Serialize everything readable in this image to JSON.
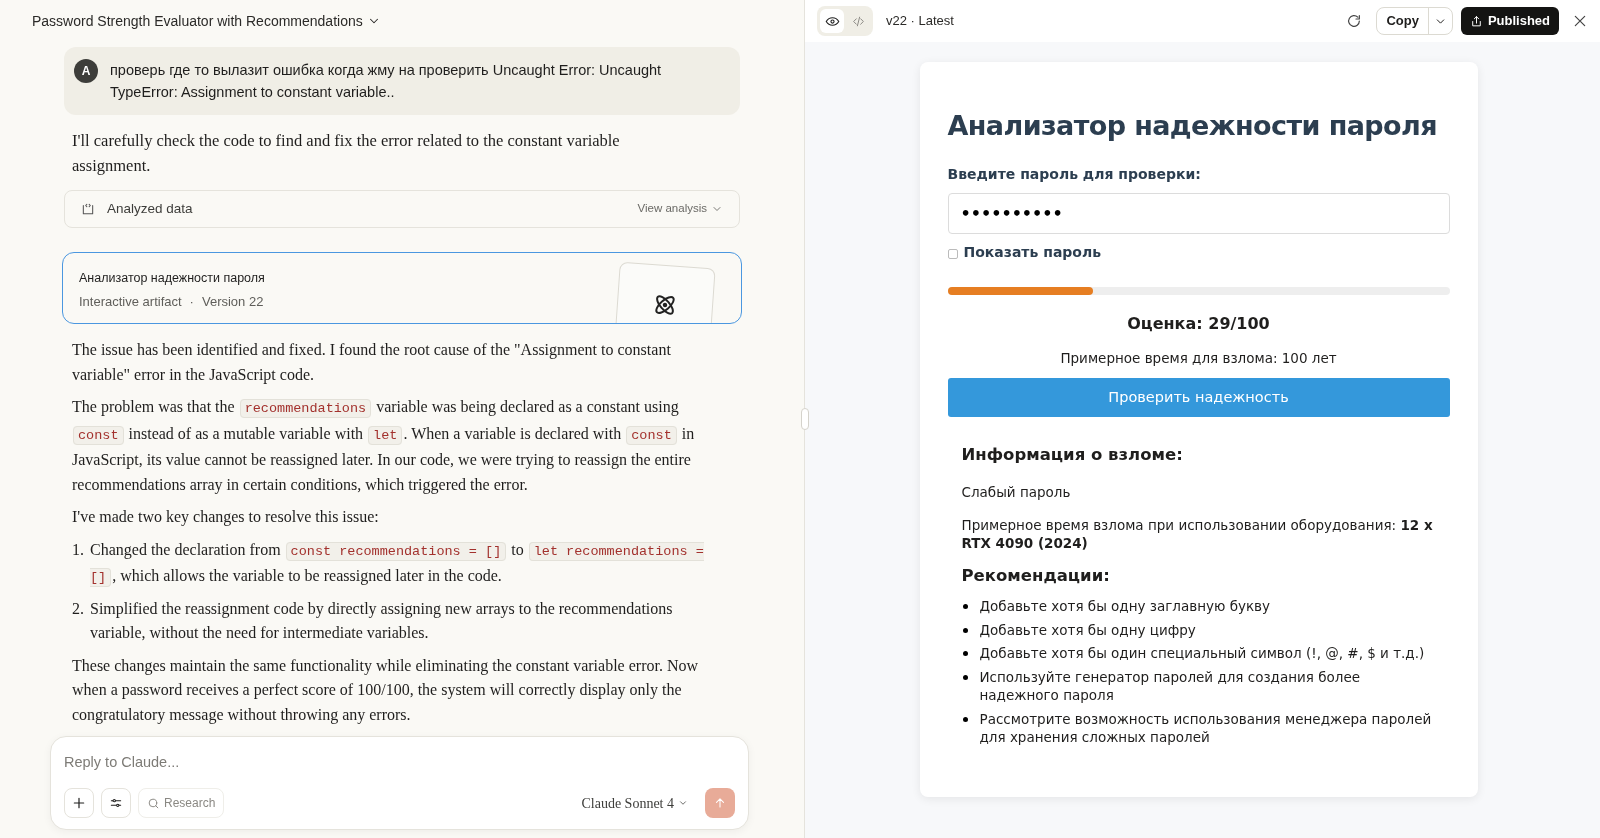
{
  "chat": {
    "title": "Password Strength Evaluator with Recommendations",
    "user_message": {
      "avatar": "A",
      "text": "проверь где то вылазит ошибка когда жму на проверить Uncaught Error: Uncaught TypeError: Assignment to constant variable.."
    },
    "intro": "I'll carefully check the code to find and fix the error related to the constant variable assignment.",
    "analysis": {
      "label": "Analyzed data",
      "action": "View analysis"
    },
    "artifact": {
      "title": "Анализатор надежности пароля",
      "type": "Interactive artifact",
      "separator": "·",
      "version": "Version 22"
    },
    "blocks": [
      {
        "kind": "p",
        "parts": [
          {
            "kind": "text",
            "text": "The issue has been identified and fixed. I found the root cause of the \"Assignment to constant variable\" error in the JavaScript code."
          }
        ]
      },
      {
        "kind": "p",
        "parts": [
          {
            "kind": "text",
            "text": "The problem was that the "
          },
          {
            "kind": "code",
            "text": "recommendations"
          },
          {
            "kind": "text",
            "text": " variable was being declared as a constant using "
          },
          {
            "kind": "code",
            "text": "const"
          },
          {
            "kind": "text",
            "text": " instead of as a mutable variable with "
          },
          {
            "kind": "code",
            "text": "let"
          },
          {
            "kind": "text",
            "text": ". When a variable is declared with "
          },
          {
            "kind": "code",
            "text": "const"
          },
          {
            "kind": "text",
            "text": " in JavaScript, its value cannot be reassigned later. In our code, we were trying to reassign the entire recommendations array in certain conditions, which triggered the error."
          }
        ]
      },
      {
        "kind": "p",
        "parts": [
          {
            "kind": "text",
            "text": "I've made two key changes to resolve this issue:"
          }
        ]
      },
      {
        "kind": "ol",
        "items": [
          {
            "number": "1.",
            "parts": [
              {
                "kind": "text",
                "text": "Changed the declaration from "
              },
              {
                "kind": "code",
                "text": "const recommendations = []"
              },
              {
                "kind": "text",
                "text": " to "
              },
              {
                "kind": "code",
                "text": "let recommendations = []"
              },
              {
                "kind": "text",
                "text": ", which allows the variable to be reassigned later in the code."
              }
            ]
          },
          {
            "number": "2.",
            "parts": [
              {
                "kind": "text",
                "text": "Simplified the reassignment code by directly assigning new arrays to the recommendations variable, without the need for intermediate variables."
              }
            ]
          }
        ]
      },
      {
        "kind": "p",
        "parts": [
          {
            "kind": "text",
            "text": "These changes maintain the same functionality while eliminating the constant variable error. Now when a password receives a perfect score of 100/100, the system will correctly display only the congratulatory message without throwing any errors."
          }
        ]
      }
    ],
    "composer": {
      "placeholder": "Reply to Claude...",
      "research": "Research",
      "model": "Claude Sonnet 4"
    }
  },
  "artifact_panel": {
    "version": "v22 · Latest",
    "views": [
      {
        "kind": "preview",
        "selected": true
      },
      {
        "kind": "code",
        "selected": false
      }
    ],
    "copy": "Copy",
    "publish": "Published",
    "app": {
      "title": "Анализатор надежности пароля",
      "field_label": "Введите пароль для проверки:",
      "password": "••••••••••",
      "show_password": {
        "label": "Показать пароль",
        "checked": false
      },
      "strength": {
        "level": 0.29,
        "color": "#e67e22"
      },
      "score": "Оценка: 29/100",
      "time": "Примерное время для взлома: 100 лет",
      "button": "Проверить надежность",
      "info_title": "Информация о взломе:",
      "info_status": "Слабый пароль",
      "info_hardware": "Примерное время взлома при использовании оборудования: **12 x RTX 4090 (2024)**",
      "rec_title": "Рекомендации:",
      "recommendations": [
        "Добавьте хотя бы одну заглавную букву",
        "Добавьте хотя бы одну цифру",
        "Добавьте хотя бы один специальный символ (!, @, #, $ и т.д.)",
        "Используйте генератор паролей для создания более надежного пароля",
        "Рассмотрите возможность использования менеджера паролей для хранения сложных паролей"
      ]
    }
  }
}
